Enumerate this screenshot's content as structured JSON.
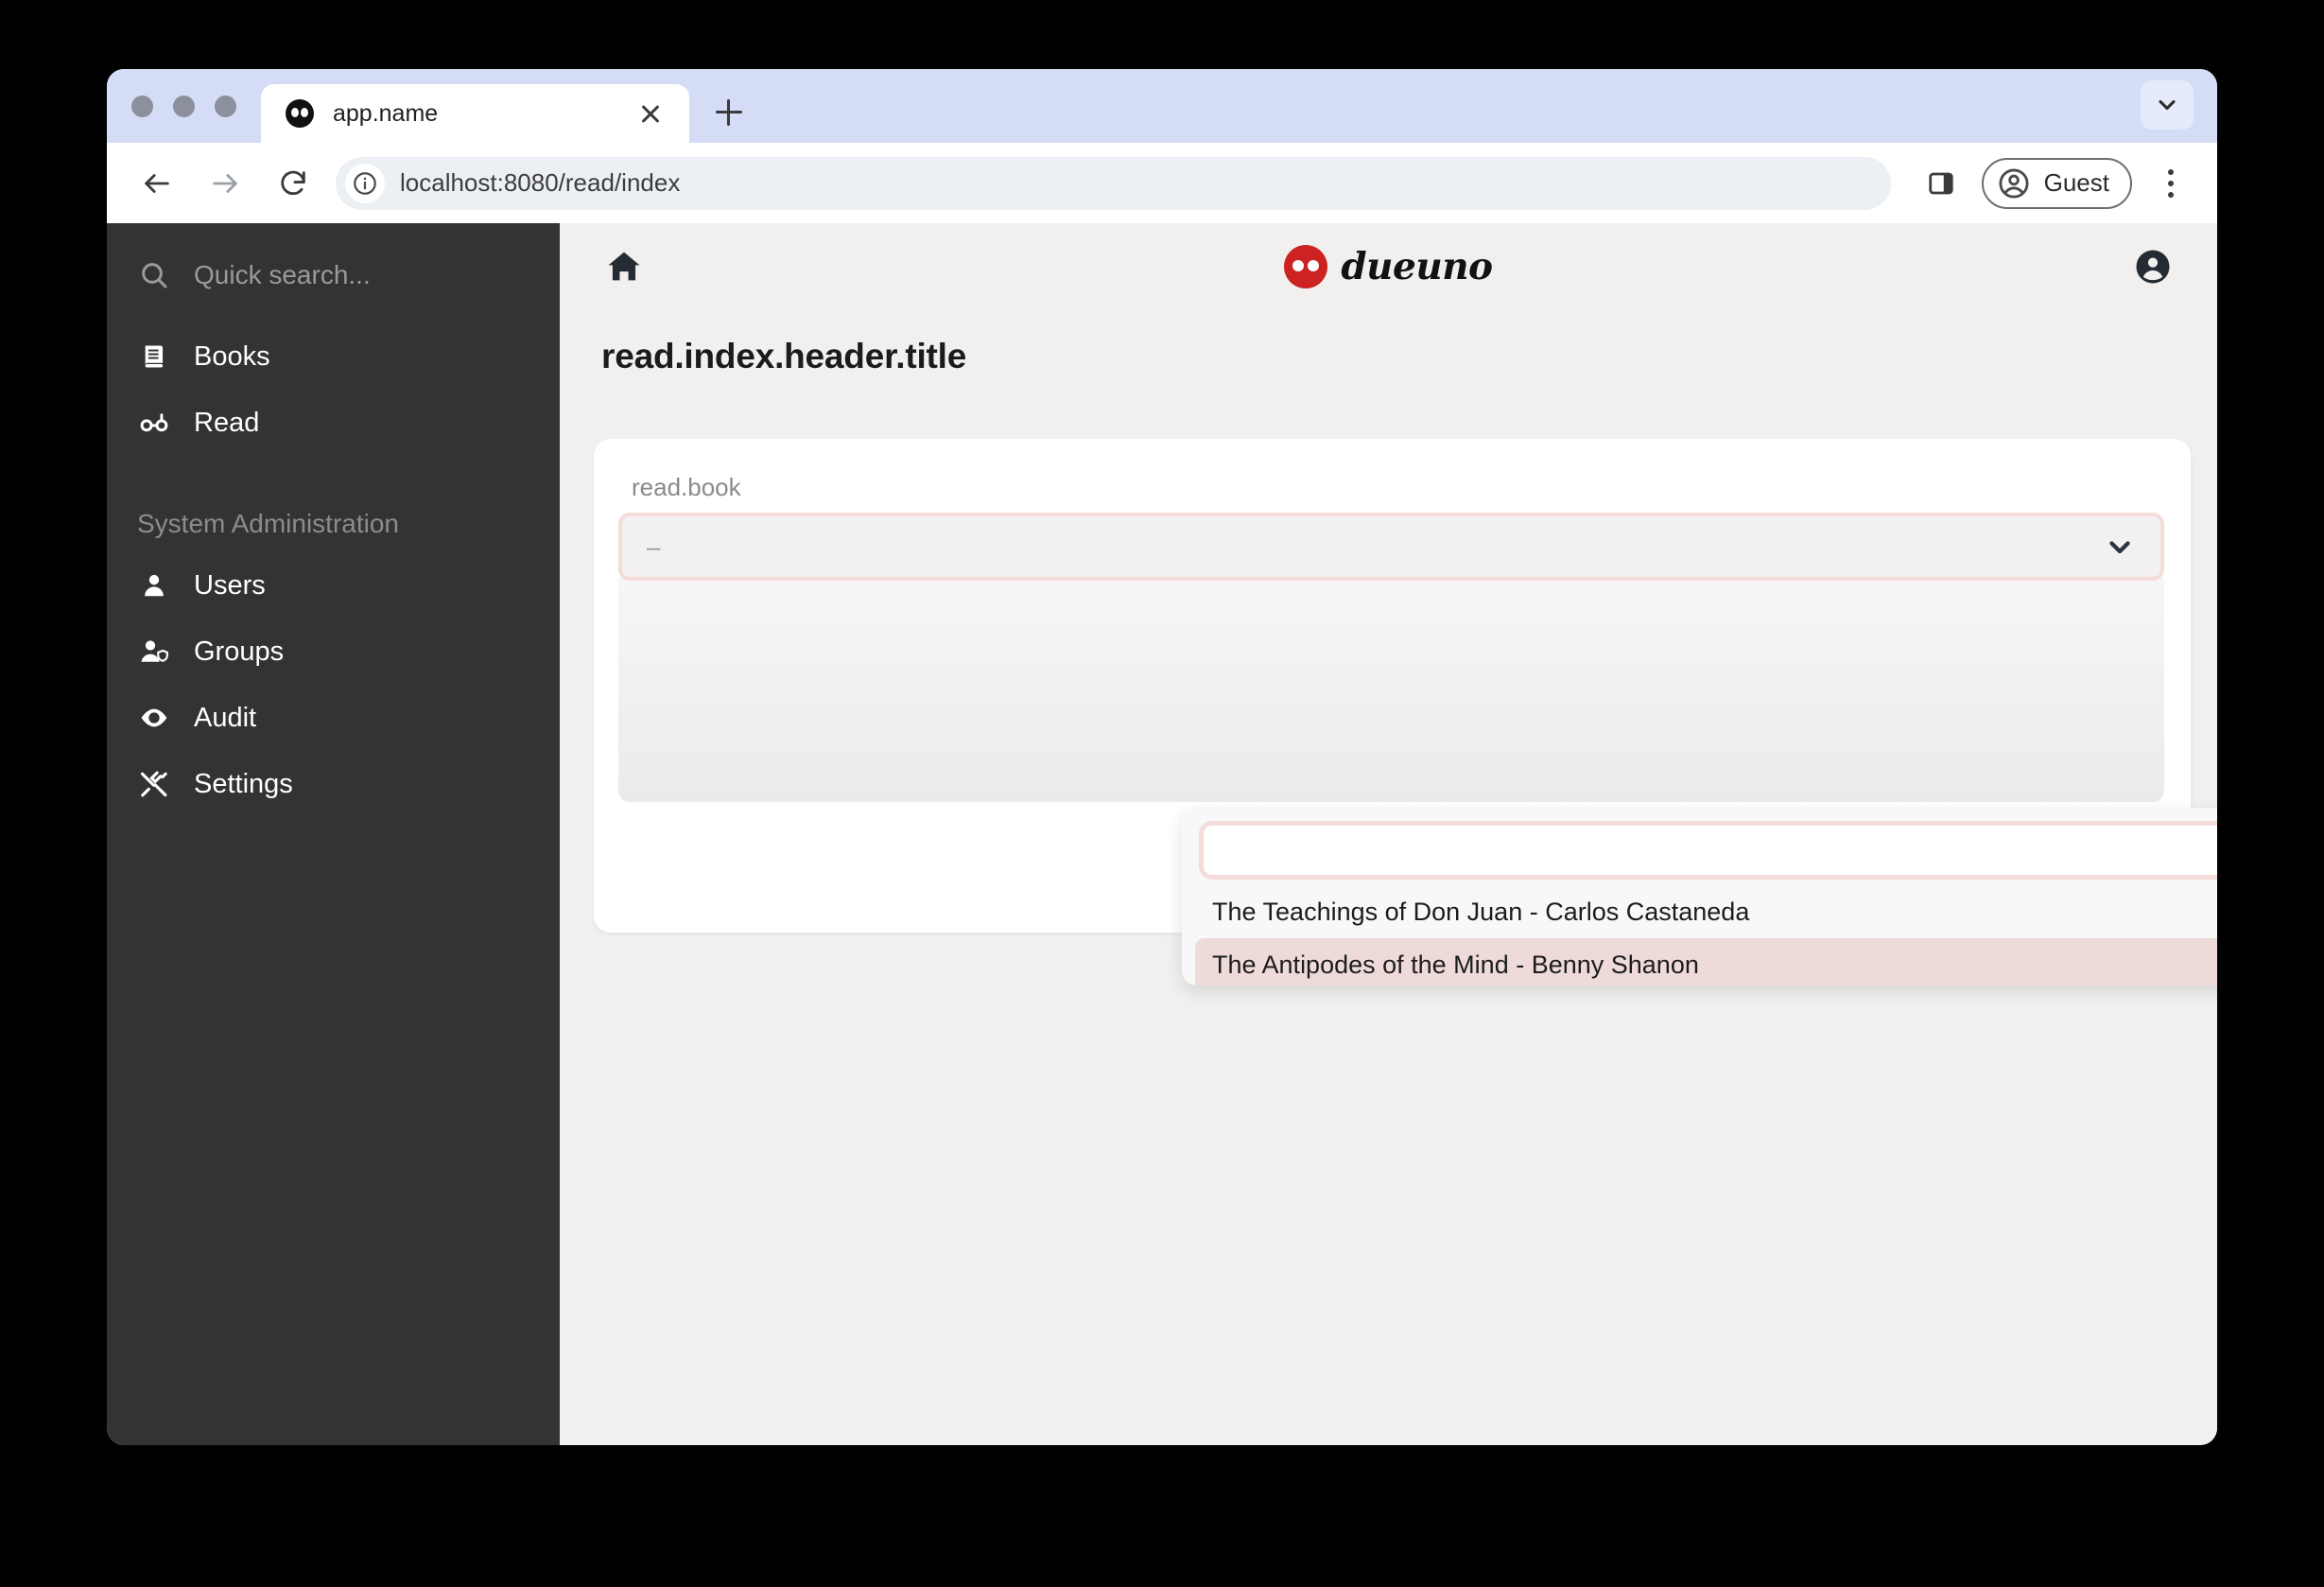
{
  "browser": {
    "traffic_lights": [
      "close",
      "minimize",
      "maximize"
    ],
    "tab": {
      "title": "app.name",
      "favicon": "dueuno-dots-icon",
      "close_icon": "close-icon"
    },
    "new_tab_icon": "plus-icon",
    "tab_list_icon": "chevron-down-icon",
    "toolbar": {
      "back_icon": "arrow-left-icon",
      "forward_icon": "arrow-right-icon",
      "reload_icon": "reload-icon",
      "info_icon": "info-circle-icon",
      "url": "localhost:8080/read/index",
      "side_panel_icon": "side-panel-icon",
      "profile_icon": "account-circle-icon",
      "profile_label": "Guest",
      "menu_icon": "kebab-menu-icon"
    }
  },
  "sidebar": {
    "search": {
      "icon": "search-icon",
      "placeholder": "Quick search..."
    },
    "items": [
      {
        "label": "Books",
        "icon": "book-icon"
      },
      {
        "label": "Read",
        "icon": "glasses-icon"
      }
    ],
    "section_title": "System Administration",
    "admin_items": [
      {
        "label": "Users",
        "icon": "person-icon"
      },
      {
        "label": "Groups",
        "icon": "group-icon"
      },
      {
        "label": "Audit",
        "icon": "eye-icon"
      },
      {
        "label": "Settings",
        "icon": "tools-icon"
      }
    ]
  },
  "app": {
    "home_icon": "home-icon",
    "brand_name": "dueuno",
    "brand_mark": "dueuno-dots-icon",
    "account_icon": "account-circle-icon",
    "page_title": "read.index.header.title"
  },
  "form": {
    "field_label": "read.book",
    "select": {
      "value": "–",
      "caret_icon": "chevron-down-icon"
    },
    "dropdown": {
      "search_value": "",
      "options": [
        {
          "label": "The Teachings of Don Juan - Carlos Castaneda",
          "selected": false
        },
        {
          "label": "The Antipodes of the Mind - Benny Shanon",
          "selected": true
        }
      ]
    }
  },
  "colors": {
    "brand_red": "#cc2222",
    "sidebar_bg": "#333333",
    "main_bg": "#f1f0ef",
    "accent_rose": "#f4dcdb",
    "selected_rose": "#eedbd9",
    "tabstrip_blue": "#d5ddf6"
  }
}
